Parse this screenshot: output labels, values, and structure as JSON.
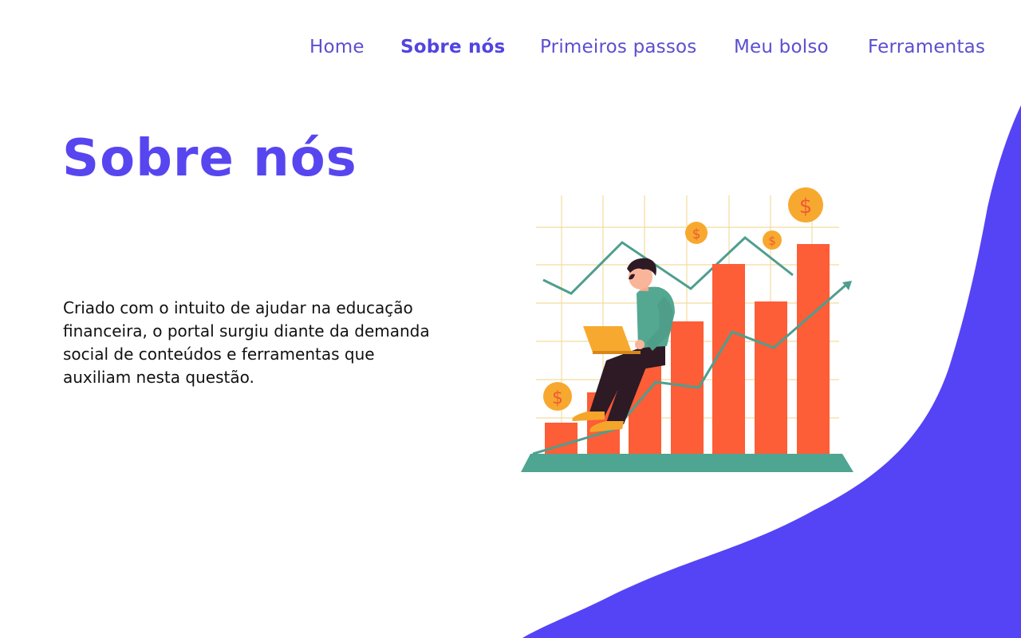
{
  "nav": {
    "items": [
      {
        "label": "Home",
        "active": false
      },
      {
        "label": "Sobre nós",
        "active": true
      },
      {
        "label": "Primeiros passos",
        "active": false
      },
      {
        "label": "Meu bolso",
        "active": false
      },
      {
        "label": "Ferramentas",
        "active": false
      }
    ]
  },
  "main": {
    "title": "Sobre nós",
    "intro": "Criado com o intuito de ajudar na educação financeira, o portal surgiu diante da demanda social de conteúdos e ferramentas que auxiliam  nesta questão."
  },
  "illustration": {
    "subject": "person-with-laptop-on-growth-chart",
    "coin_symbol": "$",
    "colors": {
      "bars": "#fd5d37",
      "line": "#4f9e8f",
      "coins": "#f7a92f",
      "coin_symbol": "#f05a35",
      "grid": "#f3dc9f",
      "base": "#4ea591"
    }
  },
  "theme": {
    "accent": "#5746f0",
    "nav_text": "#5a4fcf",
    "blob": "#5544f5",
    "background": "#ffffff"
  }
}
